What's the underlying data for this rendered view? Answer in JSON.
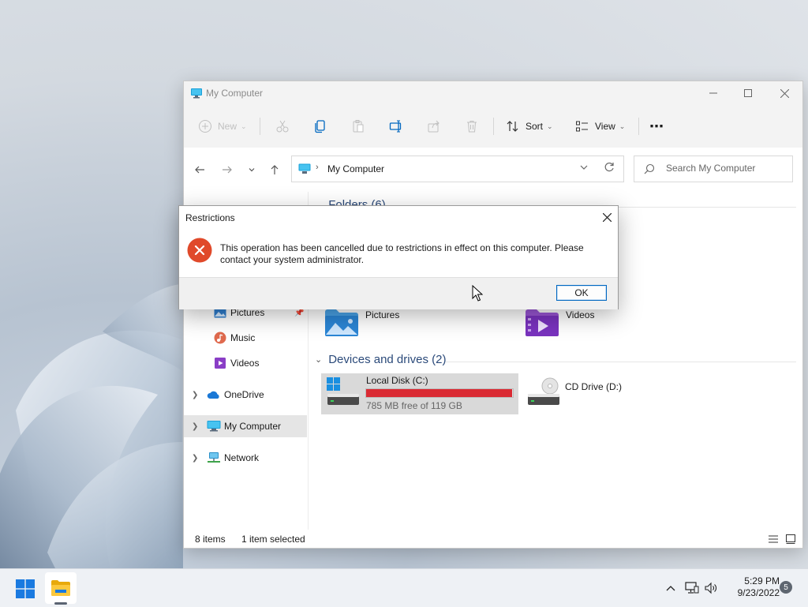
{
  "window": {
    "title": "My Computer"
  },
  "toolbar": {
    "new_label": "New",
    "sort_label": "Sort",
    "view_label": "View",
    "more_label": "⋯"
  },
  "address": {
    "crumb": "My Computer",
    "search_placeholder": "Search My Computer"
  },
  "sidebar": {
    "items": [
      {
        "label": "Pictures",
        "icon": "pictures-icon"
      },
      {
        "label": "Music",
        "icon": "music-icon"
      },
      {
        "label": "Videos",
        "icon": "videos-icon"
      },
      {
        "label": "OneDrive",
        "icon": "onedrive-icon"
      },
      {
        "label": "My Computer",
        "icon": "computer-icon"
      },
      {
        "label": "Network",
        "icon": "network-icon"
      }
    ]
  },
  "content": {
    "folders_header": "Folders (6)",
    "folders": [
      {
        "label": "Pictures",
        "icon": "pictures-folder-icon"
      },
      {
        "label": "Videos",
        "icon": "videos-folder-icon"
      }
    ],
    "devices_header": "Devices and drives (2)",
    "drives": [
      {
        "name": "Local Disk (C:)",
        "free": "785 MB free of 119 GB",
        "used_fraction": 0.994
      },
      {
        "name": "CD Drive (D:)"
      }
    ]
  },
  "status": {
    "items_count": "8 items",
    "selected": "1 item selected"
  },
  "dialog": {
    "title": "Restrictions",
    "message": "This operation has been cancelled due to restrictions in effect on this computer. Please contact your system administrator.",
    "ok_label": "OK"
  },
  "taskbar": {
    "time": "5:29 PM",
    "date": "9/23/2022",
    "notification_count": "5"
  },
  "colors": {
    "accent": "#0067c0",
    "drive_full": "#da2a33",
    "error": "#e0492a"
  }
}
